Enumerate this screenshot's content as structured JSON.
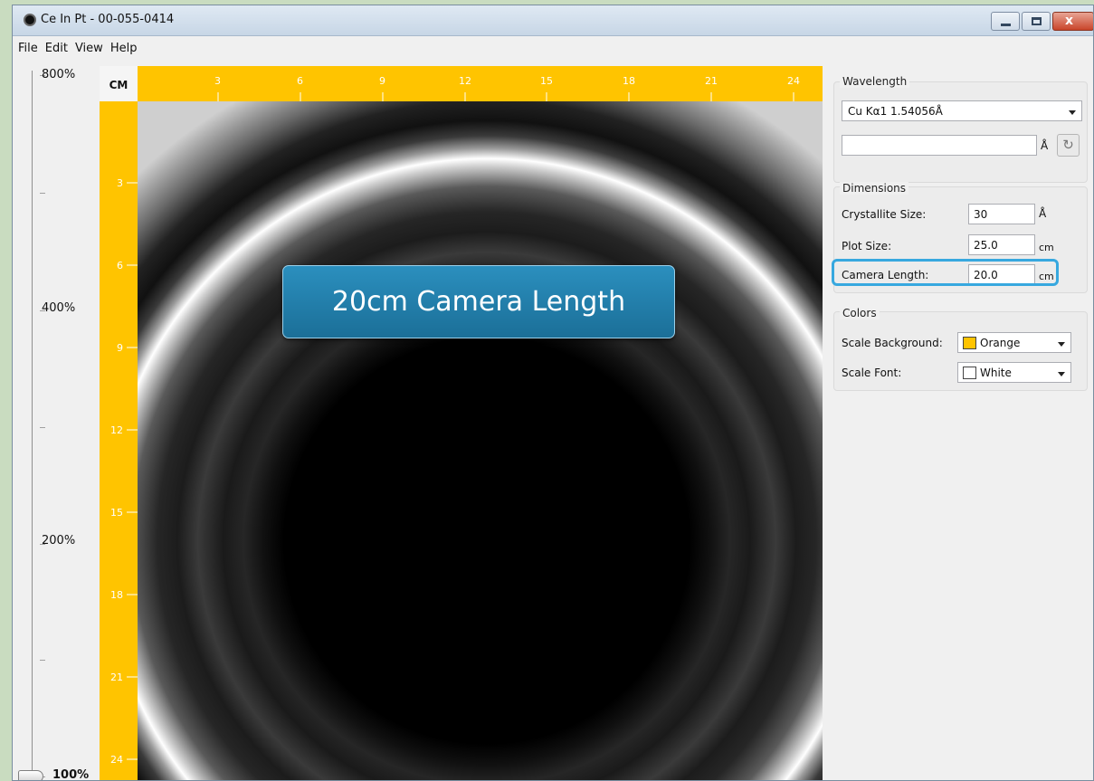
{
  "window": {
    "title": "Ce In Pt - 00-055-0414",
    "close_glyph": "x"
  },
  "menu": [
    "File",
    "Edit",
    "View",
    "Help"
  ],
  "zoom": {
    "labels": [
      "800%",
      "400%",
      "200%",
      "100%"
    ],
    "current": "100%"
  },
  "ruler": {
    "unit": "CM",
    "background_color": "#ffc400",
    "font_color": "#ffffff",
    "top_ticks": [
      "3",
      "6",
      "9",
      "12",
      "15",
      "18",
      "21",
      "24"
    ],
    "left_ticks": [
      "3",
      "6",
      "9",
      "12",
      "15",
      "18",
      "21",
      "24"
    ]
  },
  "callout": {
    "text": "20cm Camera Length"
  },
  "wavelength": {
    "title": "Wavelength",
    "selected": "Cu Kα1 1.54056Å",
    "custom_value": "",
    "unit": "Å",
    "refresh_icon": "refresh-icon"
  },
  "dimensions": {
    "title": "Dimensions",
    "crystallite_label": "Crystallite Size:",
    "crystallite_value": "30",
    "crystallite_unit": "Å",
    "plot_label": "Plot Size:",
    "plot_value": "25.0",
    "plot_unit": "cm",
    "camera_label": "Camera Length:",
    "camera_value": "20.0",
    "camera_unit": "cm"
  },
  "colors": {
    "title": "Colors",
    "scale_background_label": "Scale Background:",
    "scale_background_value": "Orange",
    "scale_background_swatch": "#ffc400",
    "scale_font_label": "Scale Font:",
    "scale_font_value": "White",
    "scale_font_swatch": "#ffffff"
  },
  "highlight_color": "#37a8df"
}
